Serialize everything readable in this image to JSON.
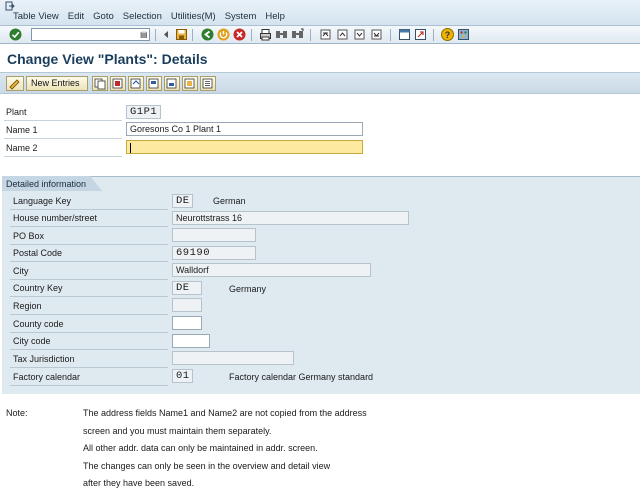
{
  "menubar": {
    "items": [
      "Table View",
      "Edit",
      "Goto",
      "Selection",
      "Utilities(M)",
      "System",
      "Help"
    ]
  },
  "title": "Change View \"Plants\": Details",
  "app_toolbar": {
    "new_entries_label": "New Entries"
  },
  "form": {
    "plant_label": "Plant",
    "plant_value": "G1P1",
    "name1_label": "Name 1",
    "name1_value": "Goresons Co 1 Plant 1",
    "name2_label": "Name 2",
    "name2_value": ""
  },
  "group": {
    "title": "Detailed information",
    "rows": [
      {
        "label": "Language Key",
        "value": "DE",
        "desc": "German"
      },
      {
        "label": "House number/street",
        "value": "Neurottstrass 16",
        "desc": ""
      },
      {
        "label": "PO Box",
        "value": "",
        "desc": ""
      },
      {
        "label": "Postal Code",
        "value": "69190",
        "desc": ""
      },
      {
        "label": "City",
        "value": "Walldorf",
        "desc": ""
      },
      {
        "label": "Country Key",
        "value": "DE",
        "desc": "Germany"
      },
      {
        "label": "Region",
        "value": "",
        "desc": ""
      },
      {
        "label": "County code",
        "value": "",
        "desc": ""
      },
      {
        "label": "City code",
        "value": "",
        "desc": ""
      },
      {
        "label": "Tax Jurisdiction",
        "value": "",
        "desc": ""
      },
      {
        "label": "Factory calendar",
        "value": "01",
        "desc": "Factory calendar Germany standard"
      }
    ]
  },
  "note": {
    "label": "Note:",
    "lines": [
      "The address fields Name1 and Name2 are not copied from the address",
      "screen and you must maintain them separately.",
      "All other addr. data can only be maintained in addr. screen.",
      "The changes can only be seen in the overview and detail view",
      "after they have been saved."
    ]
  },
  "icons": [
    "exit-icon",
    "enter-icon",
    "save-icon",
    "back-icon",
    "exit-app-icon",
    "cancel-icon",
    "print-icon",
    "find-icon",
    "find-next-icon",
    "first-page-icon",
    "prev-page-icon",
    "next-page-icon",
    "last-page-icon",
    "create-session-icon",
    "shortcut-icon",
    "help-icon",
    "layout-icon"
  ],
  "colors": {
    "title": "#1a3d5c",
    "required_field": "#fdeaa0",
    "group_bg": "#dfe9f0"
  }
}
